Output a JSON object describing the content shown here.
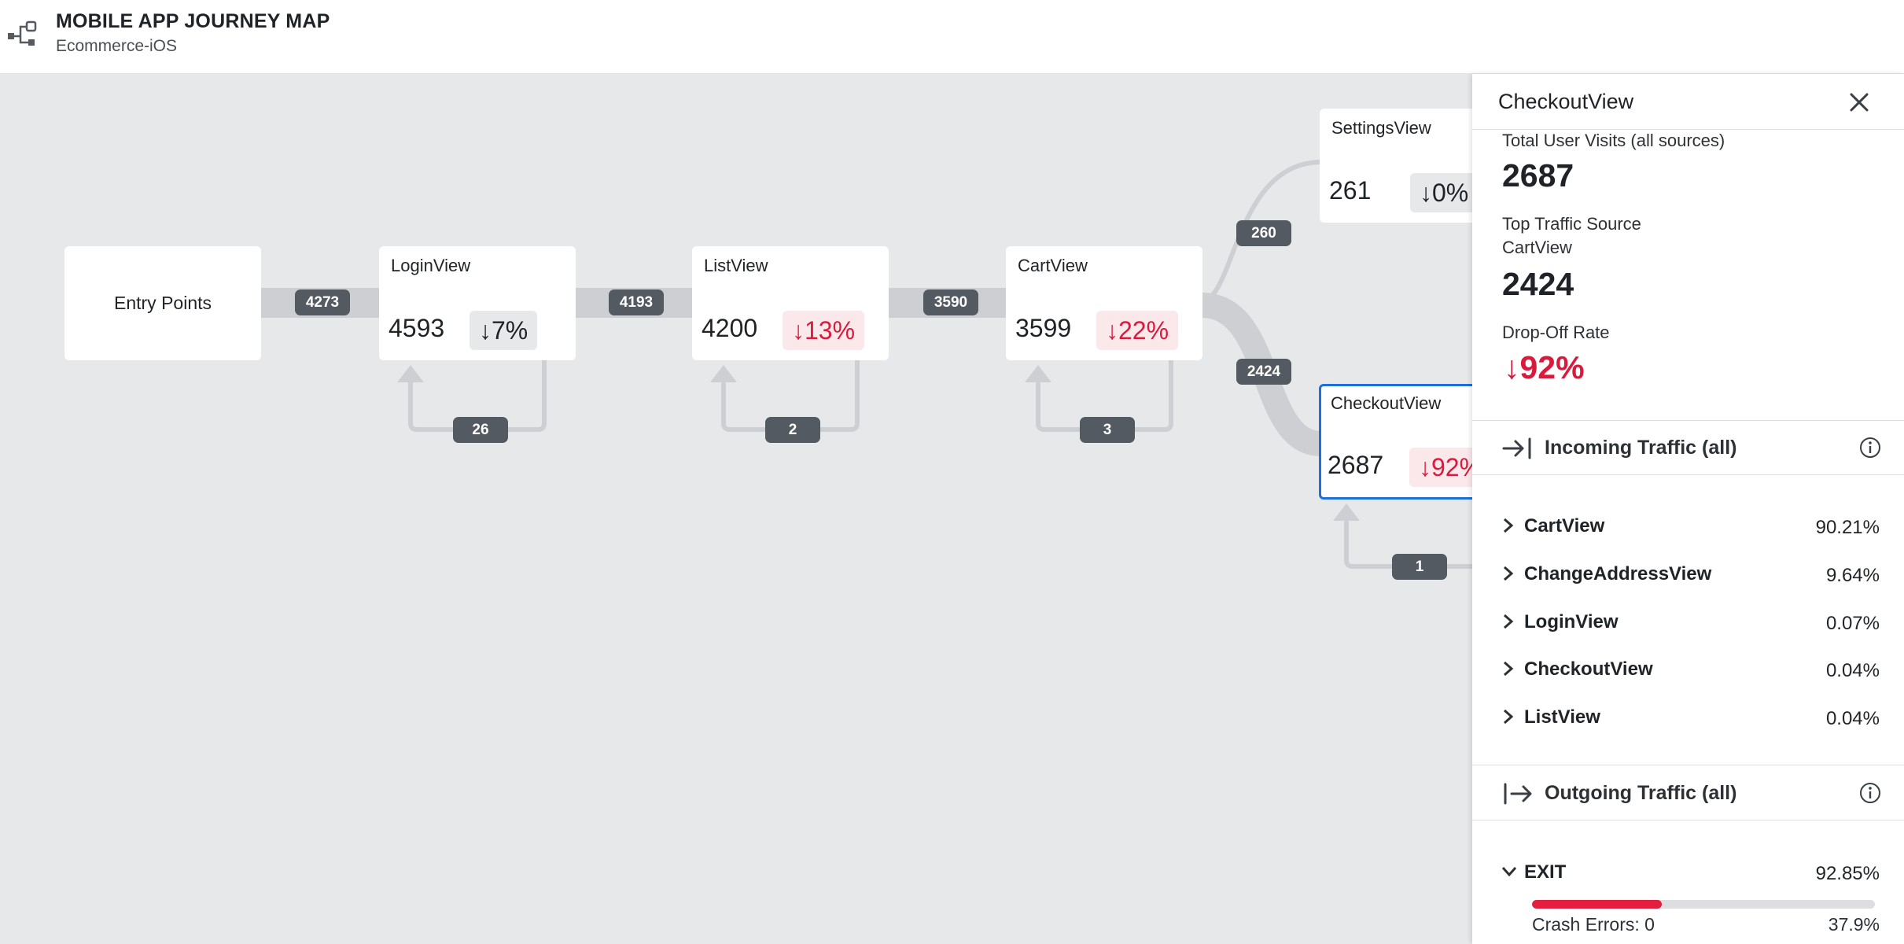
{
  "header": {
    "icon": "journey-map-icon",
    "title": "MOBILE APP JOURNEY MAP",
    "subtitle": "Ecommerce-iOS"
  },
  "colors": {
    "canvas_bg": "#e7e8ea",
    "flow": "#cdcfd2",
    "pill": "#545a61",
    "accent": "#1e6fd9",
    "negative": "#d91a3c",
    "negative_bg": "#fbe8eb"
  },
  "map": {
    "entry": {
      "label": "Entry Points"
    },
    "nodes": [
      {
        "id": "login",
        "name": "LoginView",
        "count": "4593",
        "change": "↓7%",
        "tone": "neutral",
        "loop": "26"
      },
      {
        "id": "list",
        "name": "ListView",
        "count": "4200",
        "change": "↓13%",
        "tone": "bad",
        "loop": "2"
      },
      {
        "id": "cart",
        "name": "CartView",
        "count": "3599",
        "change": "↓22%",
        "tone": "bad",
        "loop": "3"
      },
      {
        "id": "settings",
        "name": "SettingsView",
        "count": "261",
        "change": "↓0%",
        "tone": "neutral"
      },
      {
        "id": "checkout",
        "name": "CheckoutView",
        "count": "2687",
        "change": "↓92%",
        "tone": "bad",
        "loop": "1",
        "selected": true
      }
    ],
    "links": [
      {
        "from": "entry",
        "to": "login",
        "value": "4273"
      },
      {
        "from": "login",
        "to": "list",
        "value": "4193"
      },
      {
        "from": "list",
        "to": "cart",
        "value": "3590"
      },
      {
        "from": "cart",
        "to": "settings",
        "value": "260"
      },
      {
        "from": "cart",
        "to": "checkout",
        "value": "2424"
      }
    ]
  },
  "panel": {
    "title": "CheckoutView",
    "close_icon": "close-icon",
    "total_label": "Total User Visits (all sources)",
    "total_value": "2687",
    "top_source_label": "Top Traffic Source",
    "top_source_name": "CartView",
    "top_source_value": "2424",
    "drop_label": "Drop-Off Rate",
    "drop_value": "↓92%",
    "incoming": {
      "label": "Incoming Traffic (all)",
      "icon": "arrow-into-bar-icon",
      "items": [
        {
          "name": "CartView",
          "pct": "90.21%"
        },
        {
          "name": "ChangeAddressView",
          "pct": "9.64%"
        },
        {
          "name": "LoginView",
          "pct": "0.07%"
        },
        {
          "name": "CheckoutView",
          "pct": "0.04%"
        },
        {
          "name": "ListView",
          "pct": "0.04%"
        }
      ]
    },
    "outgoing": {
      "label": "Outgoing Traffic (all)",
      "icon": "arrow-out-of-bar-icon",
      "items": [
        {
          "name": "EXIT",
          "pct": "92.85%",
          "expanded": true
        }
      ]
    },
    "exit_detail": {
      "crash_label": "Crash Errors: 0",
      "crash_pct": "37.9%",
      "crash_fraction": 0.379
    }
  }
}
